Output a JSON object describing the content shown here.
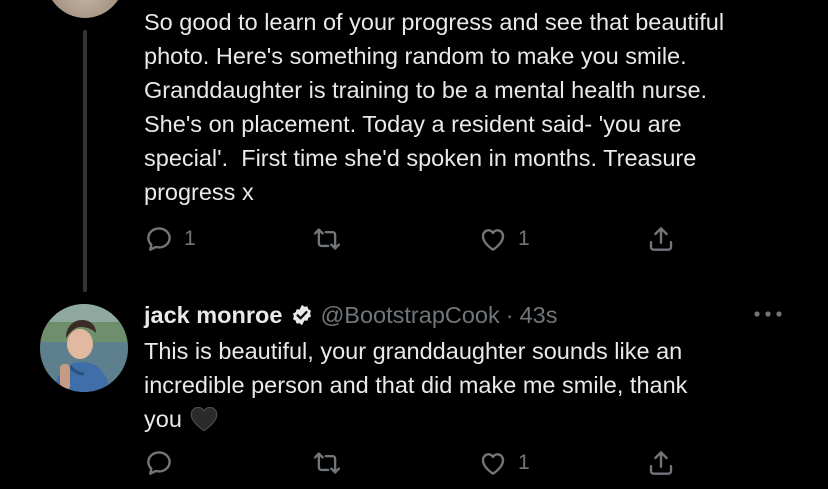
{
  "parent_tweet": {
    "text_lines": [
      "So good to learn of your progress and see that beautiful",
      "photo. Here's something random to make you smile.",
      "Granddaughter is training to be a mental health nurse.",
      "She's on placement. Today a resident said- 'you are",
      "special'.  First time she'd spoken in months. Treasure",
      "progress x"
    ],
    "actions": {
      "reply_count": "1",
      "retweet_count": "",
      "like_count": "1"
    }
  },
  "reply_tweet": {
    "display_name": "jack monroe",
    "handle": "@BootstrapCook",
    "separator": "·",
    "time": "43s",
    "text_lines": [
      "This is beautiful, your granddaughter sounds like an",
      "incredible person and that did make me smile, thank",
      "you"
    ],
    "emoji": "black-heart",
    "actions": {
      "reply_count": "",
      "retweet_count": "",
      "like_count": "1"
    }
  },
  "colors": {
    "background": "#000000",
    "text": "#e7e9ea",
    "muted": "#71767b",
    "thread_line": "#333639"
  },
  "icons": [
    "reply-icon",
    "retweet-icon",
    "like-icon",
    "share-icon",
    "verified-icon",
    "more-icon",
    "black-heart-emoji"
  ]
}
